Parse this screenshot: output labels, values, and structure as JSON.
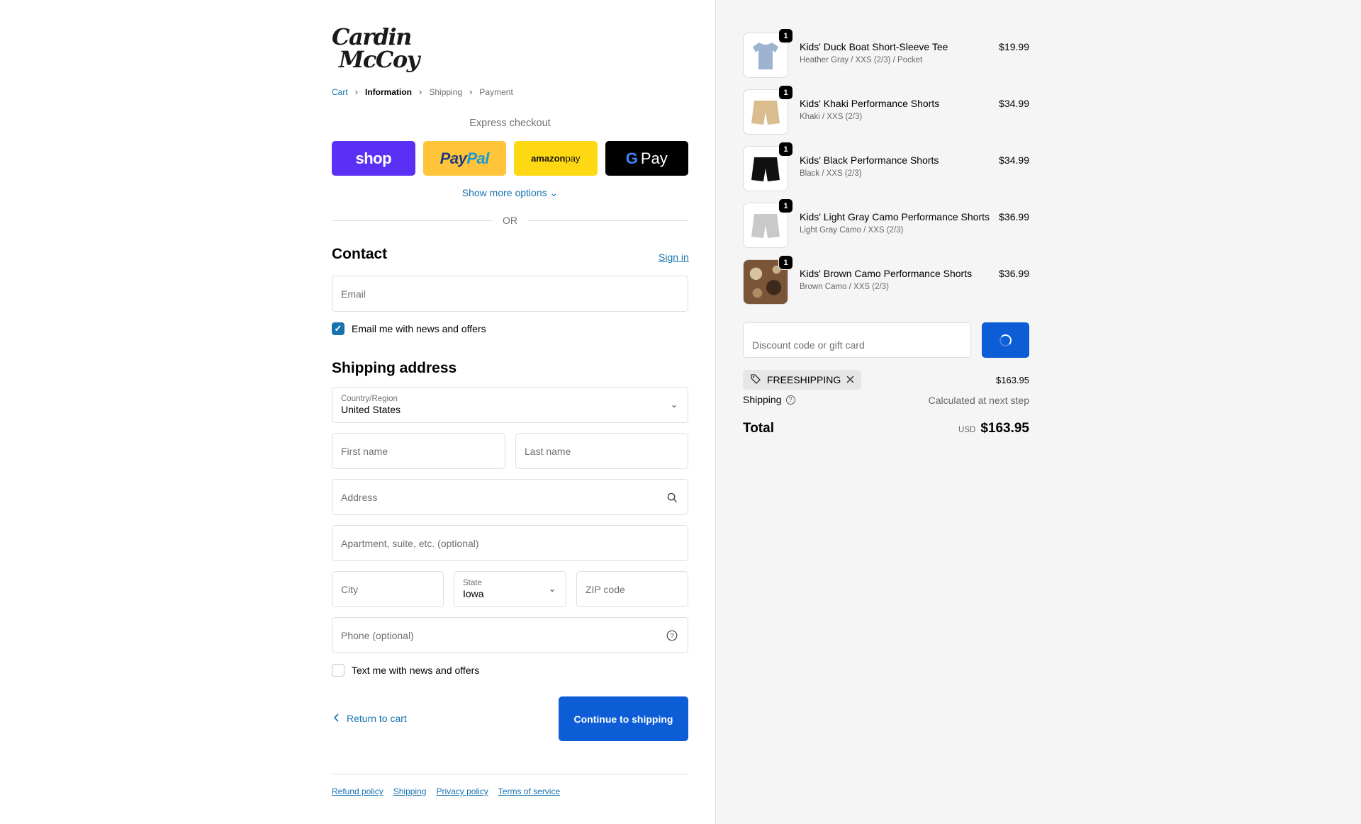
{
  "brand": {
    "line1": "Cardin",
    "line2": "McCoy"
  },
  "breadcrumb": [
    "Cart",
    "Information",
    "Shipping",
    "Payment"
  ],
  "express": {
    "title": "Express checkout",
    "shop": "shop",
    "paypal_a": "Pay",
    "paypal_b": "Pal",
    "amazon_a": "amazon",
    "amazon_b": " pay",
    "gpay_g": "G",
    "gpay": "Pay",
    "more": "Show more options",
    "or": "OR"
  },
  "contact": {
    "heading": "Contact",
    "signin": "Sign in",
    "email_placeholder": "Email",
    "newsletter": "Email me with news and offers",
    "newsletter_checked": true
  },
  "shipping": {
    "heading": "Shipping address",
    "country_label": "Country/Region",
    "country_value": "United States",
    "first_name": "First name",
    "last_name": "Last name",
    "address": "Address",
    "apartment": "Apartment, suite, etc. (optional)",
    "city": "City",
    "state_label": "State",
    "state_value": "Iowa",
    "zip": "ZIP code",
    "phone": "Phone (optional)",
    "sms": "Text me with news and offers",
    "sms_checked": false
  },
  "actions": {
    "return": "Return to cart",
    "continue": "Continue to shipping"
  },
  "footer": [
    "Refund policy",
    "Shipping",
    "Privacy policy",
    "Terms of service"
  ],
  "cart": {
    "items": [
      {
        "qty": "1",
        "name": "Kids' Duck Boat Short-Sleeve Tee",
        "variant": "Heather Gray / XXS (2/3) / Pocket",
        "price": "$19.99",
        "color": "#9db3cf"
      },
      {
        "qty": "1",
        "name": "Kids' Khaki Performance Shorts",
        "variant": "Khaki / XXS (2/3)",
        "price": "$34.99",
        "color": "#d9bd8f"
      },
      {
        "qty": "1",
        "name": "Kids' Black Performance Shorts",
        "variant": "Black / XXS (2/3)",
        "price": "$34.99",
        "color": "#111111"
      },
      {
        "qty": "1",
        "name": "Kids' Light Gray Camo Performance Shorts",
        "variant": "Light Gray Camo / XXS (2/3)",
        "price": "$36.99",
        "color": "#c9c9c9"
      },
      {
        "qty": "1",
        "name": "Kids' Brown Camo Performance Shorts",
        "variant": "Brown Camo / XXS (2/3)",
        "price": "$36.99",
        "color": "#7a5538"
      }
    ],
    "discount_placeholder": "Discount code or gift card",
    "code": "FREESHIPPING",
    "subtotal": "$163.95",
    "shipping_label": "Shipping",
    "shipping_value": "Calculated at next step",
    "total_label": "Total",
    "currency": "USD",
    "total": "$163.95"
  }
}
